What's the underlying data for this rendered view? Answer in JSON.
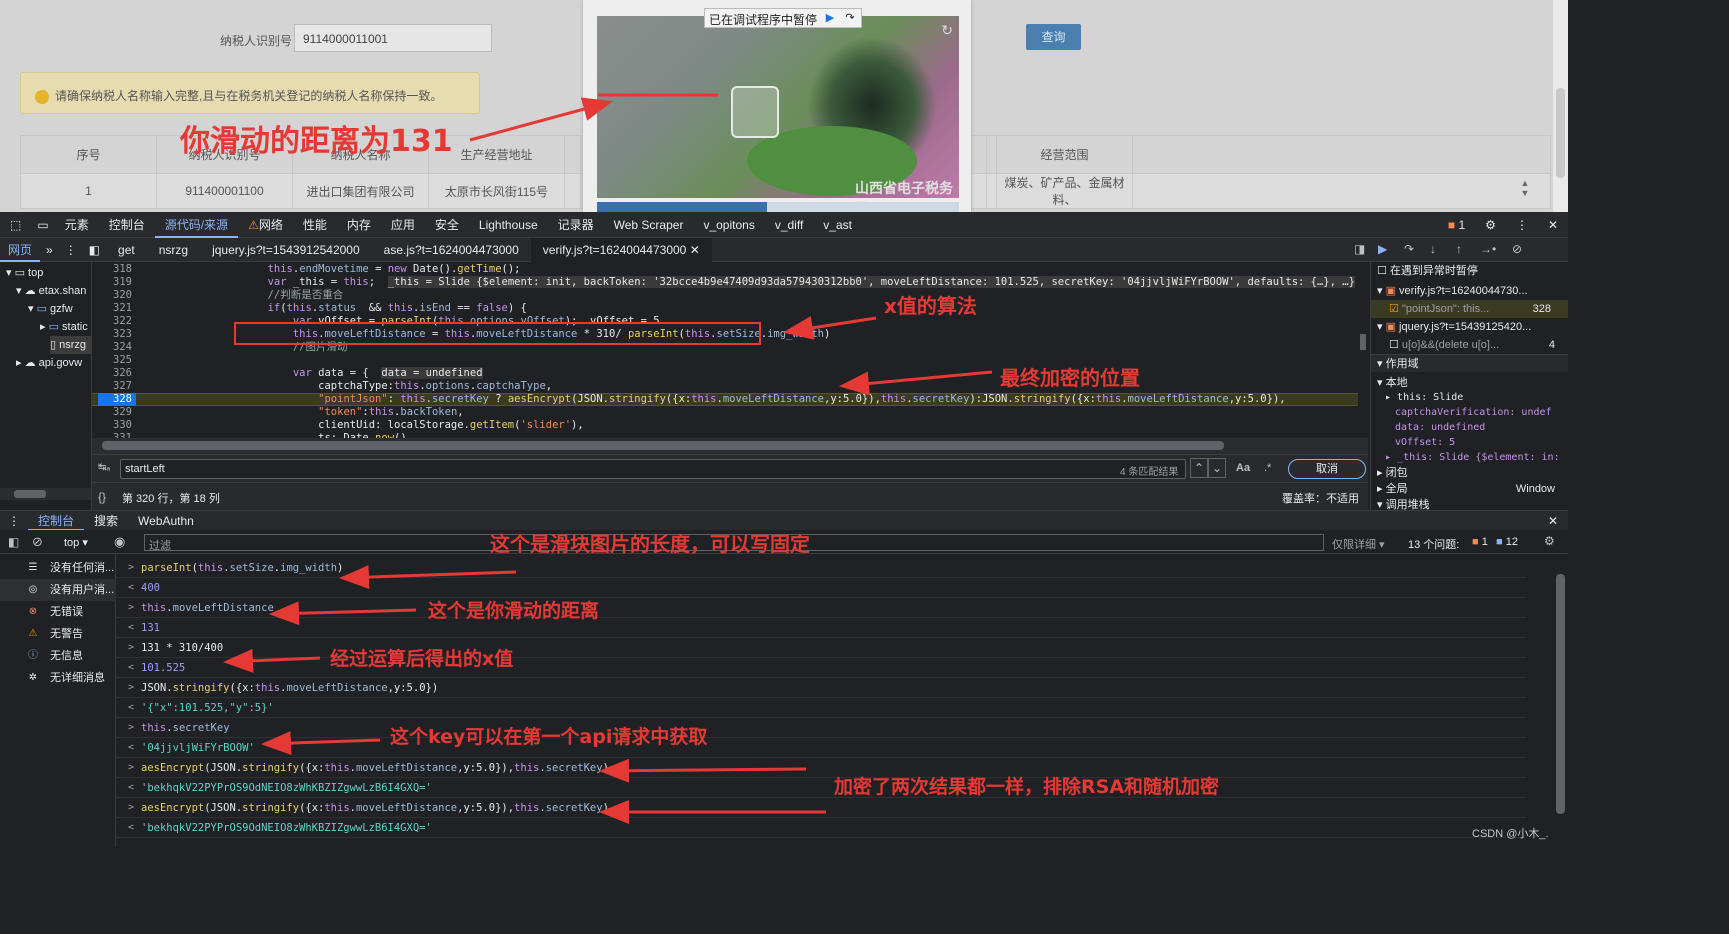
{
  "webpage": {
    "taxpayer_id_label": "纳税人识别号",
    "taxpayer_id_value": "9114000011001",
    "query_button": "查询",
    "notice": "请确保纳税人名称输入完整,且与在税务机关登记的纳税人名称保持一致。",
    "table_headers": [
      "序号",
      "纳税人识别号",
      "纳税人名称",
      "生产经营地址",
      "",
      "",
      "",
      "经营范围"
    ],
    "table_row": [
      "1",
      "911400001100",
      "进出口集团有限公司",
      "太原市长风街115号",
      "",
      "",
      "",
      "煤炭、矿产品、金属材料、"
    ]
  },
  "captcha": {
    "paused_text": "已在调试程序中暂停",
    "watermark": "山西省电子税务局"
  },
  "annotations": {
    "slide_distance": "你滑动的距离为131",
    "x_algorithm": "x值的算法",
    "final_encrypt": "最终加密的位置",
    "img_length": "这个是滑块图片的长度，可以写固定",
    "your_distance": "这个是你滑动的距离",
    "x_value": "经过运算后得出的x值",
    "key_source": "这个key可以在第一个api请求中获取",
    "same_result": "加密了两次结果都一样，排除RSA和随机加密"
  },
  "devtools": {
    "main_tabs": [
      "元素",
      "控制台",
      "源代码/来源",
      "网络",
      "性能",
      "内存",
      "应用",
      "安全",
      "Lighthouse",
      "记录器",
      "Web Scraper",
      "v_opitons",
      "v_diff",
      "v_ast"
    ],
    "active_main_tab": "源代码/来源",
    "issues_badge": "1",
    "file_tabs": [
      "get",
      "nsrzg",
      "jquery.js?t=1543912542000",
      "ase.js?t=1624004473000",
      "verify.js?t=1624004473000"
    ],
    "active_file_tab": "verify.js?t=1624004473000",
    "nav_tab": "网页",
    "nav_tree": [
      "top",
      "etax.shan",
      "gzfw",
      "static",
      "nsrzg",
      "api.govw"
    ],
    "line_numbers": [
      "318",
      "319",
      "320",
      "321",
      "322",
      "323",
      "324",
      "325",
      "326",
      "327",
      "328",
      "329",
      "330",
      "331"
    ],
    "search_query": "startLeft",
    "search_count": "4 条匹配结果",
    "search_case": "Aa",
    "search_regex": ".*",
    "search_cancel": "取消",
    "cursor_position": "第 320 行，第 18 列",
    "coverage": "覆盖率：不适用",
    "right_pane": {
      "pause_on_exception": "在遇到异常时暂停",
      "bp_file1": "verify.js?t=16240044730...",
      "bp_line1_code": "\"pointJson\": this...",
      "bp_line1_num": "328",
      "bp_file2": "jquery.js?t=15439125420...",
      "bp_line2_code": "u[o]&&(delete u[o]...",
      "bp_line2_num": "4",
      "scope_title": "作用域",
      "local_title": "本地",
      "scope_this": "this: Slide",
      "scope_captcha": "captchaVerification: undef",
      "scope_data": "data: undefined",
      "scope_voffset": "vOffset: 5",
      "scope_this2": "_this: Slide {$element: in:",
      "closure": "闭包",
      "global": "全局",
      "global_val": "Window",
      "callstack": "调用堆栈"
    },
    "console_tabs": [
      "控制台",
      "搜索",
      "WebAuthn"
    ],
    "console_context": "top",
    "filter_placeholder": "过滤",
    "log_level": "仅限详细",
    "issues_count": "13 个问题:",
    "issues_err": "1",
    "issues_info": "12",
    "sidebar": [
      "没有任何消...",
      "没有用户消...",
      "无错误",
      "无警告",
      "无信息",
      "无详细消息"
    ]
  },
  "console_rows": [
    {
      "dir": ">",
      "text": "parseInt(this.setSize.img_width)",
      "kind": "in"
    },
    {
      "dir": "<",
      "text": "400",
      "kind": "num"
    },
    {
      "dir": ">",
      "text": "this.moveLeftDistance",
      "kind": "in"
    },
    {
      "dir": "<",
      "text": "131",
      "kind": "num"
    },
    {
      "dir": ">",
      "text": "131 * 310/400",
      "kind": "in"
    },
    {
      "dir": "<",
      "text": "101.525",
      "kind": "num"
    },
    {
      "dir": ">",
      "text": "JSON.stringify({x:this.moveLeftDistance,y:5.0})",
      "kind": "in"
    },
    {
      "dir": "<",
      "text": "'{\"x\":101.525,\"y\":5}'",
      "kind": "str"
    },
    {
      "dir": ">",
      "text": "this.secretKey",
      "kind": "in"
    },
    {
      "dir": "<",
      "text": "'04jjvljWiFYrBOOW'",
      "kind": "str"
    },
    {
      "dir": ">",
      "text": "aesEncrypt(JSON.stringify({x:this.moveLeftDistance,y:5.0}),this.secretKey)",
      "kind": "in"
    },
    {
      "dir": "<",
      "text": "'bekhqkV22PYPrOS9OdNEIO8zWhKBZIZgwwLzB6I4GXQ='",
      "kind": "str"
    },
    {
      "dir": ">",
      "text": "aesEncrypt(JSON.stringify({x:this.moveLeftDistance,y:5.0}),this.secretKey)",
      "kind": "in"
    },
    {
      "dir": "<",
      "text": "'bekhqkV22PYPrOS9OdNEIO8zWhKBZIZgwwLzB6I4GXQ='",
      "kind": "str"
    }
  ],
  "watermark_footer": "CSDN @小木_."
}
